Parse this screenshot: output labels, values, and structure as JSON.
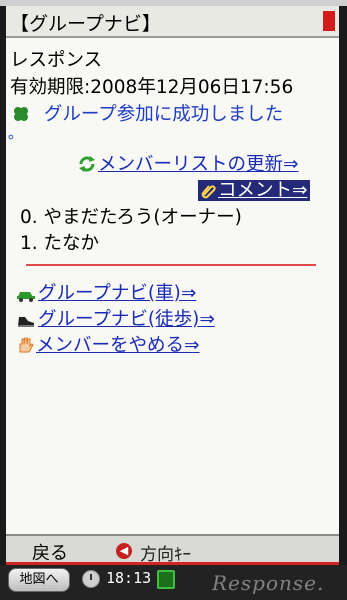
{
  "title_bar": {
    "title": "【グループナビ】"
  },
  "header": {
    "line1": "レスポンス",
    "line2": "有効期限:2008年12月06日17:56"
  },
  "status": {
    "message": "グループ参加に成功しました",
    "marker": "。"
  },
  "actions": {
    "refresh_members": "メンバーリストの更新⇒",
    "comment": "コメント⇒"
  },
  "members": [
    {
      "text": "0. やまだたろう(オーナー)"
    },
    {
      "text": "1. たなか"
    }
  ],
  "links": {
    "nav_car": "グループナビ(車)⇒",
    "nav_walk": "グループナビ(徒歩)⇒",
    "quit": "メンバーをやめる⇒"
  },
  "softkeys": {
    "left": "戻る",
    "right": "方向ｷｰ"
  },
  "statusbar": {
    "map_button": "地図へ",
    "time": "18:13"
  },
  "watermark": "Response.",
  "colors": {
    "link": "#1a2bb8",
    "highlight_bg": "#242a78",
    "accent_red": "#d12424",
    "divider": "#e24a4a"
  },
  "icons": {
    "success": "clover-icon",
    "refresh": "refresh-icon",
    "comment": "paperclip-icon",
    "car": "car-icon",
    "walk": "shoe-icon",
    "quit": "hand-icon"
  }
}
